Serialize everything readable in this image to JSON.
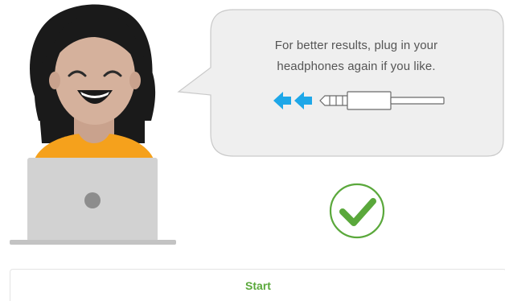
{
  "prompt": {
    "line1": "For better results, plug in your",
    "line2": "headphones again if you like."
  },
  "actions": {
    "start_label": "Start"
  },
  "colors": {
    "accent_green": "#5aa83b",
    "arrow_blue": "#1ea7e8",
    "bubble_fill": "#efefef",
    "bubble_border": "#c9c9c9"
  },
  "icons": {
    "arrows": "double-left-arrow-icon",
    "plug": "headphone-plug-icon",
    "status": "check-circle-icon",
    "avatar": "smiling-person-illustration",
    "laptop": "laptop-icon"
  }
}
